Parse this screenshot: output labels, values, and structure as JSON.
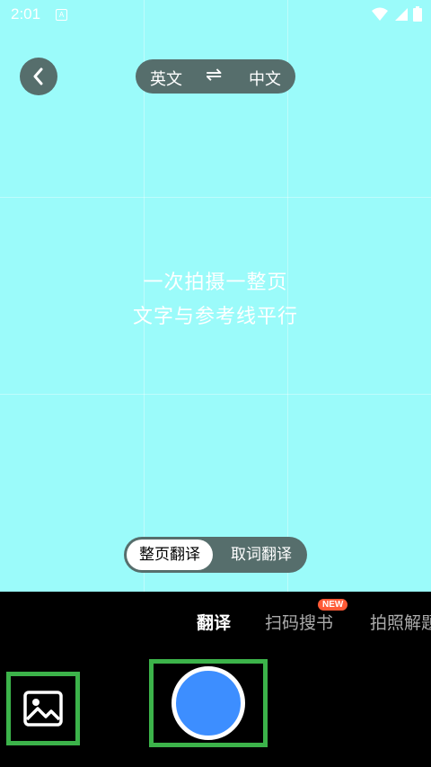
{
  "status_bar": {
    "time": "2:01",
    "notification_icon_letter": "A",
    "icons": [
      "wifi-icon",
      "signal-icon",
      "battery-icon"
    ]
  },
  "camera": {
    "language": {
      "source": "英文",
      "swap_symbol": "⇌",
      "target": "中文"
    },
    "hint_line1": "一次拍摄一整页",
    "hint_line2": "文字与参考线平行",
    "mode": {
      "active": "整页翻译",
      "inactive": "取词翻译"
    }
  },
  "bottom": {
    "tabs": [
      {
        "label": "翻译"
      },
      {
        "label": "扫码搜书",
        "badge": "NEW"
      },
      {
        "label": "拍照解题"
      }
    ]
  },
  "colors": {
    "viewfinder": "#9bfbfa",
    "shutter": "#3d8eff",
    "highlight": "#3cb34a",
    "badge": "#ff5a36"
  }
}
